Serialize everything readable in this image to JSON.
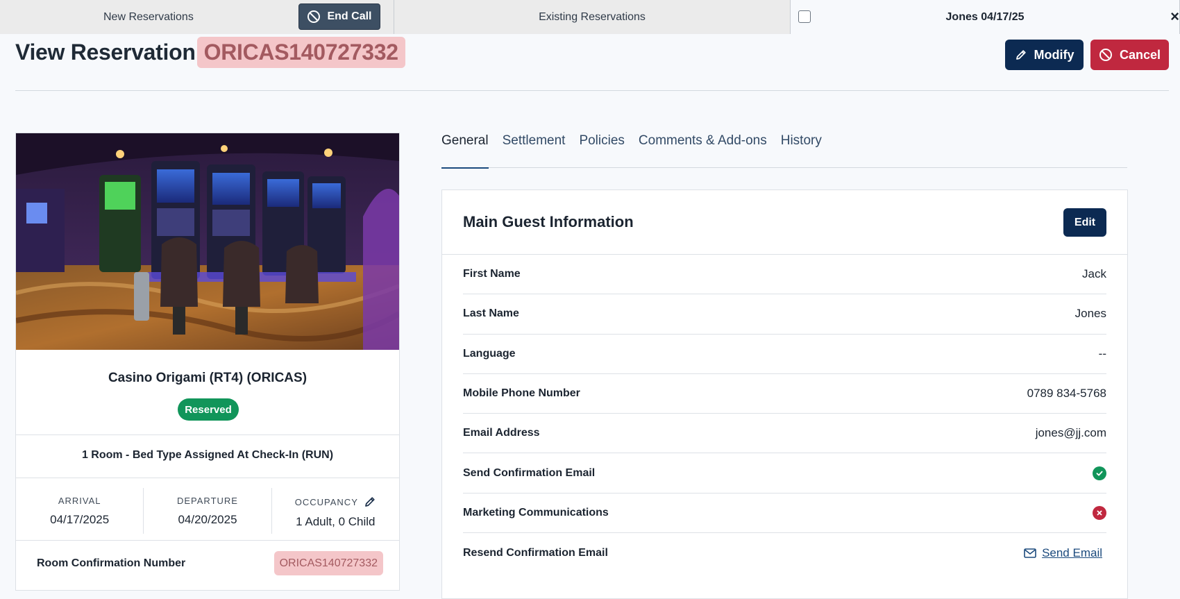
{
  "tabbar": {
    "new_reservations": "New Reservations",
    "end_call": "End Call",
    "existing_reservations": "Existing Reservations",
    "active_tab": "Jones 04/17/25",
    "close": "×"
  },
  "header": {
    "title": "View Reservation",
    "reservation_code": "ORICAS140727332",
    "modify": "Modify",
    "cancel": "Cancel"
  },
  "card": {
    "property_name": "Casino Origami (RT4) (ORICAS)",
    "status": "Reserved",
    "room_type": "1 Room - Bed Type Assigned At Check-In (RUN)",
    "arrival_label": "ARRIVAL",
    "arrival": "04/17/2025",
    "departure_label": "DEPARTURE",
    "departure": "04/20/2025",
    "occupancy_label": "OCCUPANCY",
    "occupancy": "1 Adult, 0 Child",
    "confirmation_label": "Room Confirmation Number",
    "confirmation_number": "ORICAS140727332"
  },
  "tabs": [
    "General",
    "Settlement",
    "Policies",
    "Comments & Add-ons",
    "History"
  ],
  "guest": {
    "title": "Main Guest Information",
    "edit": "Edit",
    "fields": [
      {
        "label": "First Name",
        "value": "Jack"
      },
      {
        "label": "Last Name",
        "value": "Jones"
      },
      {
        "label": "Language",
        "value": "--"
      },
      {
        "label": "Mobile Phone Number",
        "value": "0789 834-5768"
      },
      {
        "label": "Email Address",
        "value": "jones@jj.com"
      },
      {
        "label": "Send Confirmation Email",
        "value": "check-icon"
      },
      {
        "label": "Marketing Communications",
        "value": "x-icon"
      },
      {
        "label": "Resend Confirmation Email",
        "value": "Send Email"
      }
    ]
  },
  "colors": {
    "primary": "#0c2a52",
    "danger": "#c0283f",
    "success": "#11955a",
    "highlight": "#f4c6c9"
  }
}
